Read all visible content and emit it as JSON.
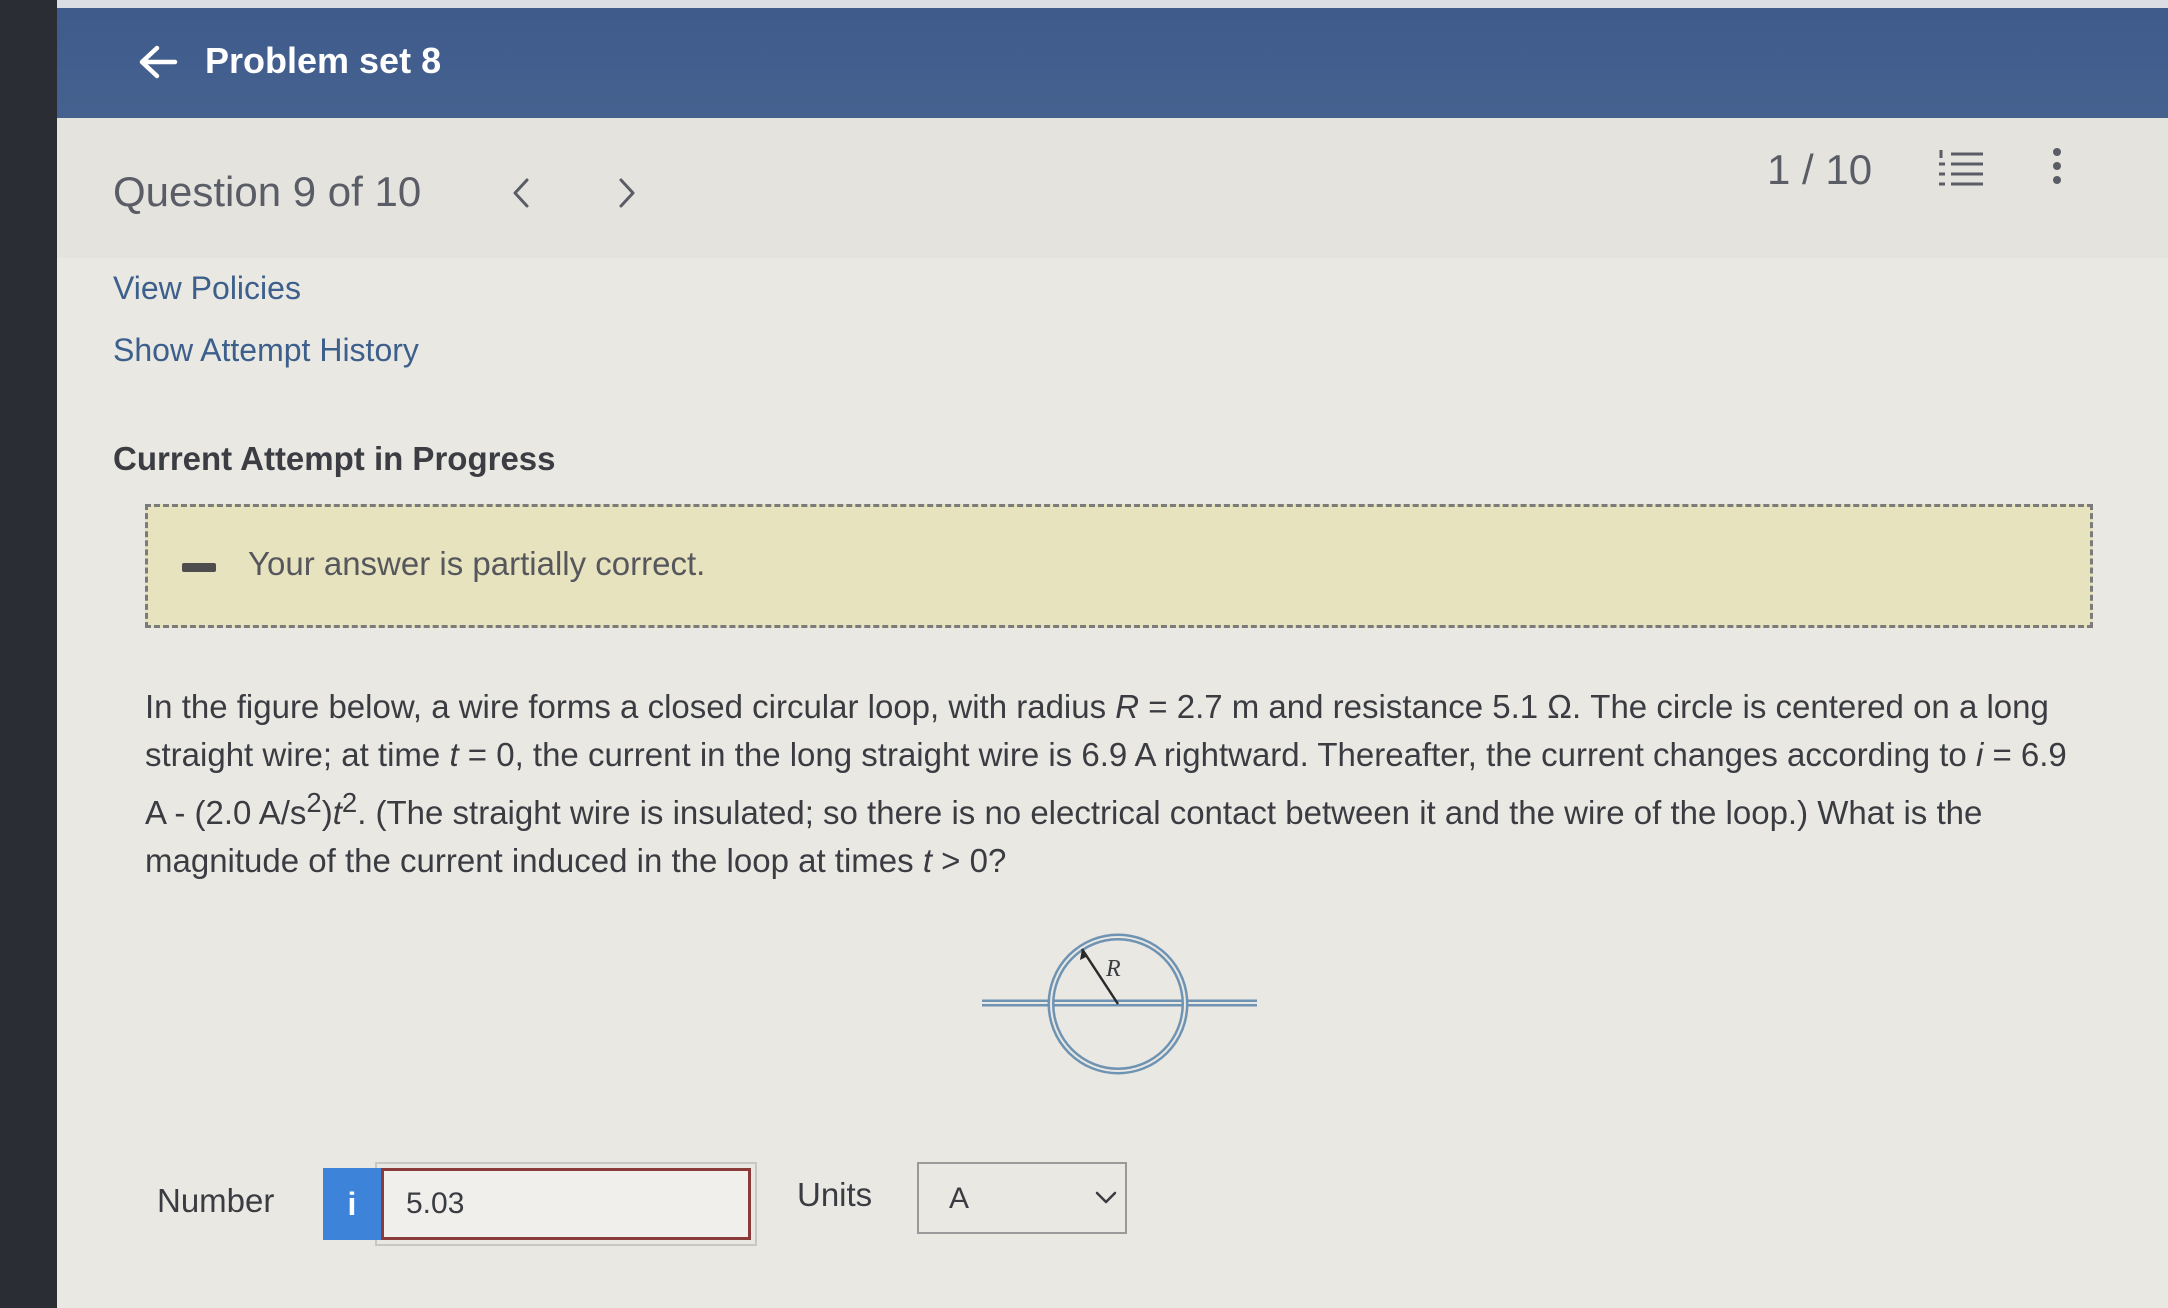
{
  "topbar": {
    "title": "Problem set 8",
    "back_icon": "arrow-left-icon"
  },
  "question": {
    "header": "Question 9 of 10",
    "counter": "1 / 10",
    "prev_icon": "chevron-left-icon",
    "next_icon": "chevron-right-icon",
    "list_icon": "numbered-list-icon",
    "more_icon": "vertical-ellipsis-icon"
  },
  "links": {
    "view_policies": "View Policies",
    "show_attempt_history": "Show Attempt History"
  },
  "attempt": {
    "title": "Current Attempt in Progress",
    "feedback": "Your answer is partially correct."
  },
  "problem": {
    "line1_a": "In the figure below, a wire forms a closed circular loop, with radius ",
    "line1_R": "R",
    "line1_b": " = 2.7 m and resistance 5.1 Ω. The circle is centered on a long",
    "line2_a": "straight wire; at time ",
    "line2_t": "t",
    "line2_b": " = 0, the current in the long straight wire is 6.9 A rightward. Thereafter, the current changes according to ",
    "line2_i": "i",
    "line2_c": " = 6.9",
    "line3_a": "A - (2.0 A/s",
    "line3_sup": "2",
    "line3_b": ")",
    "line3_t": "t",
    "line3_sup2": "2",
    "line3_c": ". (The straight wire is insulated; so there is no electrical contact between it and the wire of the loop.) What is the",
    "line4_a": "magnitude of the current induced in the loop at times ",
    "line4_t": "t",
    "line4_b": " > 0?",
    "figure_label": "R"
  },
  "answer": {
    "number_label": "Number",
    "info_label": "i",
    "number_value": "5.03",
    "units_label": "Units",
    "units_value": "A"
  },
  "colors": {
    "topbar": "#45628f",
    "link": "#3d5f8c",
    "feedback_bg": "#e8e3bf",
    "info_button": "#3d83d9",
    "input_border": "#8b3a3a",
    "figure_stroke": "#6f93b3"
  }
}
